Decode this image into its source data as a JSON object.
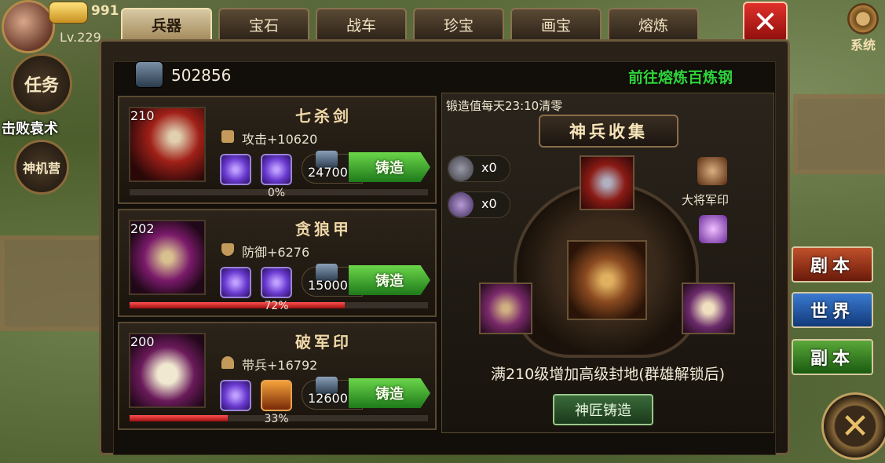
{
  "player": {
    "gold": "991",
    "level": "Lv.229"
  },
  "left_menu": [
    {
      "label": "任务",
      "caption": "击败袁术"
    },
    {
      "label": "神机营",
      "caption": ""
    }
  ],
  "tabs": [
    "兵器",
    "宝石",
    "战车",
    "珍宝",
    "画宝",
    "熔炼"
  ],
  "active_tab": "兵器",
  "system_label": "系统",
  "resource": {
    "amount": "502856"
  },
  "goto_link": "前往熔炼百炼钢",
  "weapons": [
    {
      "level": "210",
      "name": "七杀剑",
      "stat": "攻击+10620",
      "cost": "24700",
      "forge": "铸造",
      "progress_pct": 0,
      "progress_label": "0%"
    },
    {
      "level": "202",
      "name": "贪狼甲",
      "stat": "防御+6276",
      "cost": "15000",
      "forge": "铸造",
      "progress_pct": 72,
      "progress_label": "72%"
    },
    {
      "level": "200",
      "name": "破军印",
      "stat": "带兵+16792",
      "cost": "12600",
      "forge": "铸造",
      "progress_pct": 33,
      "progress_label": "33%"
    }
  ],
  "collection": {
    "reset_notice": "锻造值每天23:10清零",
    "title": "神兵收集",
    "items": [
      {
        "count": "x0"
      },
      {
        "count": "x0"
      }
    ],
    "seal_name": "大将军印",
    "unlock_text": "满210级增加高级封地(群雄解锁后)",
    "master_button": "神匠铸造"
  },
  "side_menu": [
    "剧本",
    "世界",
    "副本"
  ],
  "colors": {
    "accent_green": "#2fd43a",
    "close_red": "#c8201c"
  }
}
